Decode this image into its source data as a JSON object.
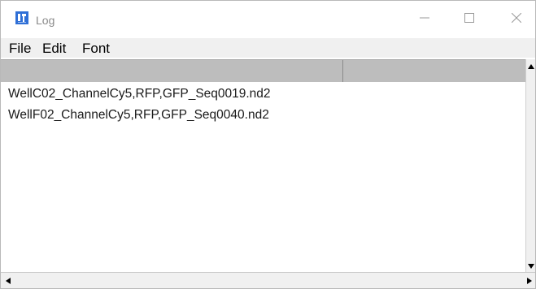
{
  "window": {
    "title": "Log",
    "icon": "imagej-icon",
    "controls": [
      "minimize-icon",
      "maximize-icon",
      "close-icon"
    ]
  },
  "menubar": {
    "file": "File",
    "edit": "Edit",
    "font": "Font"
  },
  "table": {
    "columns": [
      "",
      ""
    ]
  },
  "log": {
    "lines": [
      "WellC02_ChannelCy5,RFP,GFP_Seq0019.nd2",
      "WellF02_ChannelCy5,RFP,GFP_Seq0040.nd2"
    ]
  },
  "colors": {
    "header_bg": "#bdbdbd",
    "menubar_bg": "#f0f0f0",
    "icon_accent": "#2f6fd6"
  }
}
